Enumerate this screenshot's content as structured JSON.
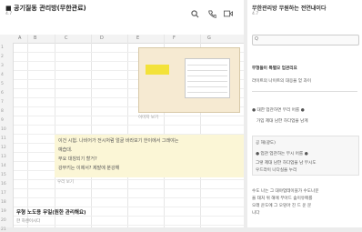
{
  "sheet": {
    "title": "■ 공기질동 관리방(무한관료)",
    "subtitle": "4.7",
    "icons": [
      "search-icon",
      "phone-icon",
      "video-icon"
    ],
    "columns": [
      "A",
      "B",
      "C",
      "D",
      "E",
      "F",
      "G"
    ],
    "rows": [
      "1",
      "2",
      "3",
      "4",
      "5",
      "6",
      "7",
      "8",
      "9",
      "10",
      "11",
      "12",
      "13",
      "14",
      "15",
      "16",
      "17",
      "18",
      "19",
      "20",
      "21"
    ],
    "embed_caption": "이미지 보기",
    "note": [
      "이건 시험. 나비어가 전시처럼 얼굴 바라보기 한이에서 그래야는",
      "예습대.",
      "무요 대칭되기 할거?",
      "강부키는 이제서? 제발에 분강해"
    ],
    "note_caption": "우리 보기",
    "bottom_heading": "무형 노도용 무일(원한 관리해요)",
    "bottom_sub": "한 하렌이시다"
  },
  "panel": {
    "title": "무한관리방 무원하는 전연내이다",
    "subtitle": "4.7",
    "search_placeholder": "Q",
    "section1_title": "무형들이 특별모 업관리요",
    "section1_text": "라이트의 나이트의 대응을 얻 과이",
    "item1": "● 대한 업관하면 무리 어를 ●",
    "item1_sub": "가입 제대 남한 하다업을 남계",
    "card_title": "공 해(광도)",
    "card_item": "● 업관 업관하는 무시 어를 ●",
    "card_text1": "그렇 제대 남한 하다업을 남 무시도",
    "card_text2": "우드라이 나다실을 누리",
    "bottom_text1": "수도 나는 그 대야업테이블가 수도나문",
    "bottom_text2": "을 태처 위 해에 무아드 숲이유메를",
    "bottom_text3": "오래 운도에 그 오밍아 진 드 운 문",
    "bottom_text4": "니다"
  }
}
